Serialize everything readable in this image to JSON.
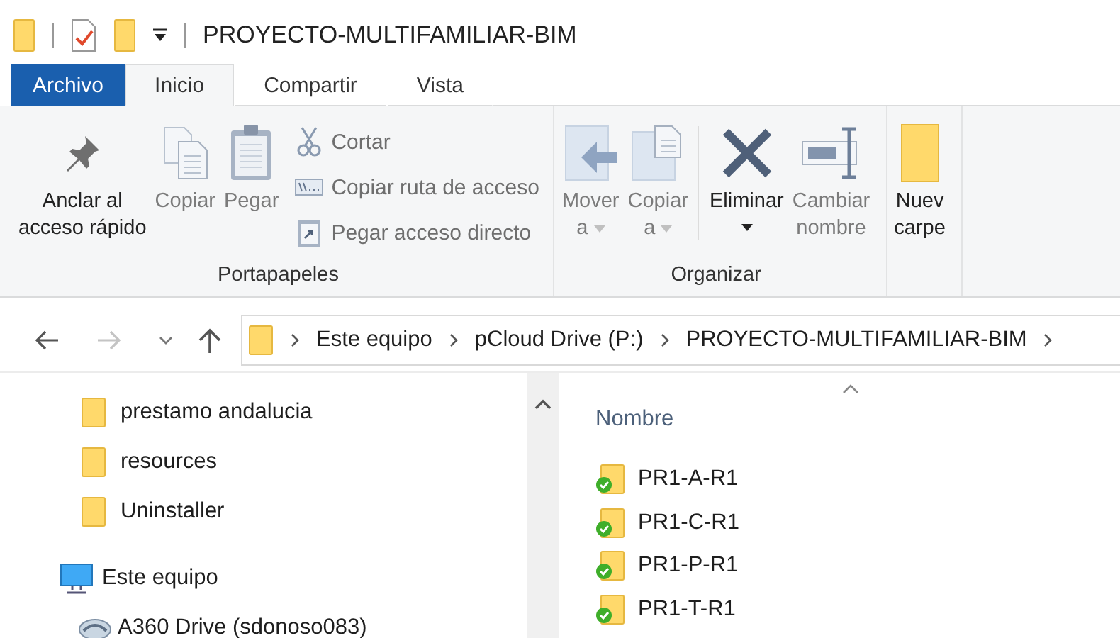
{
  "title_bar": {
    "title": "PROYECTO-MULTIFAMILIAR-BIM"
  },
  "tabs": [
    {
      "label": "Archivo",
      "kind": "file",
      "selected": false
    },
    {
      "label": "Inicio",
      "kind": "tab",
      "selected": true
    },
    {
      "label": "Compartir",
      "kind": "tab",
      "selected": false
    },
    {
      "label": "Vista",
      "kind": "tab",
      "selected": false
    }
  ],
  "ribbon": {
    "groups": [
      {
        "label": "Portapapeles",
        "buttons": [
          {
            "lines": [
              "Anclar al",
              "acceso rápido"
            ],
            "disabled": false
          },
          {
            "lines": [
              "Copiar"
            ],
            "disabled": true
          },
          {
            "lines": [
              "Pegar"
            ],
            "disabled": true
          }
        ],
        "small_buttons": [
          {
            "label": "Cortar",
            "disabled": true
          },
          {
            "label": "Copiar ruta de acceso",
            "disabled": true
          },
          {
            "label": "Pegar acceso directo",
            "disabled": true
          }
        ]
      },
      {
        "label": "Organizar",
        "buttons": [
          {
            "lines": [
              "Mover",
              "a"
            ],
            "disabled": true,
            "dropdown": true
          },
          {
            "lines": [
              "Copiar",
              "a"
            ],
            "disabled": true,
            "dropdown": true
          },
          {
            "lines": [
              "Eliminar"
            ],
            "disabled": false,
            "dropdown": true,
            "separator_before": true
          },
          {
            "lines": [
              "Cambiar",
              "nombre"
            ],
            "disabled": true
          }
        ]
      },
      {
        "buttons": [
          {
            "lines": [
              "Nuev",
              "carpe"
            ],
            "disabled": false
          }
        ]
      }
    ]
  },
  "address_bar": {
    "back": {
      "disabled": false
    },
    "forward": {
      "disabled": true
    },
    "path": [
      "Este equipo",
      "pCloud Drive (P:)",
      "PROYECTO-MULTIFAMILIAR-BIM"
    ]
  },
  "nav_pane": {
    "items_above": [
      {
        "label": "prestamo andalucia",
        "kind": "folder"
      },
      {
        "label": "resources",
        "kind": "folder"
      },
      {
        "label": "Uninstaller",
        "kind": "folder"
      }
    ],
    "tree": [
      {
        "label": "Este equipo",
        "kind": "computer",
        "children": [
          {
            "label": "A360 Drive (sdonoso083)",
            "kind": "drive"
          }
        ]
      }
    ]
  },
  "file_list": {
    "columns": [
      {
        "label": "Nombre",
        "sorted": true
      }
    ],
    "rows": [
      {
        "name": "PR1-A-R1",
        "synced": true
      },
      {
        "name": "PR1-C-R1",
        "synced": true
      },
      {
        "name": "PR1-P-R1",
        "synced": true
      },
      {
        "name": "PR1-T-R1",
        "synced": true
      }
    ]
  }
}
